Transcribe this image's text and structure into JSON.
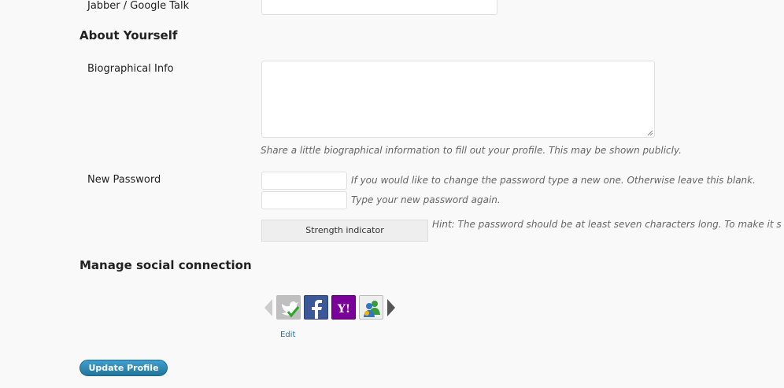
{
  "contact": {
    "jabber_label": "Jabber / Google Talk",
    "jabber_value": ""
  },
  "about": {
    "title": "About Yourself",
    "bio_label": "Biographical Info",
    "bio_value": "",
    "bio_description": "Share a little biographical information to fill out your profile. This may be shown publicly."
  },
  "password": {
    "label": "New Password",
    "new_value": "",
    "new_description": "If you would like to change the password type a new one. Otherwise leave this blank.",
    "repeat_value": "",
    "repeat_description": "Type your new password again.",
    "strength_label": "Strength indicator",
    "hint": "Hint: The password should be at least seven characters long. To make it s"
  },
  "social": {
    "title": "Manage social connection",
    "icons": [
      {
        "name": "twitter-icon",
        "connected": true
      },
      {
        "name": "facebook-icon",
        "connected": false
      },
      {
        "name": "yahoo-icon",
        "text": "Y!",
        "connected": false
      },
      {
        "name": "messenger-icon",
        "connected": false
      }
    ],
    "edit_label": "Edit"
  },
  "actions": {
    "update_label": "Update Profile"
  },
  "colors": {
    "link": "#21759b",
    "button": "#21759b",
    "facebook": "#3b5998",
    "yahoo": "#7b0099",
    "check": "#2aa52a"
  }
}
